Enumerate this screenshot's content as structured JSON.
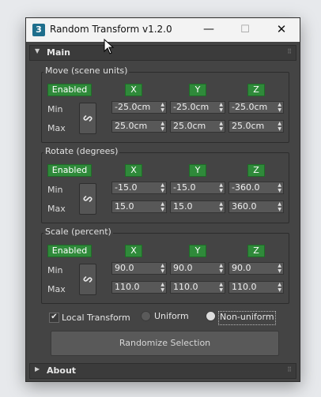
{
  "window": {
    "title": "Random Transform v1.2.0",
    "app_icon_text": "3",
    "controls": {
      "minimize": "—",
      "maximize": "☐",
      "close": "✕"
    }
  },
  "rollouts": {
    "main": {
      "label": "Main",
      "expanded": true,
      "arrow": "▼",
      "grip": "⠿"
    },
    "about": {
      "label": "About",
      "expanded": false,
      "arrow": "▶",
      "grip": "⠿"
    }
  },
  "groups": {
    "move": {
      "title": "Move (scene units)",
      "enabled_label": "Enabled",
      "x_label": "X",
      "y_label": "Y",
      "z_label": "Z",
      "min_label": "Min",
      "max_label": "Max",
      "min": {
        "x": "-25.0cm",
        "y": "-25.0cm",
        "z": "-25.0cm"
      },
      "max": {
        "x": "25.0cm",
        "y": "25.0cm",
        "z": "25.0cm"
      }
    },
    "rotate": {
      "title": "Rotate (degrees)",
      "enabled_label": "Enabled",
      "x_label": "X",
      "y_label": "Y",
      "z_label": "Z",
      "min_label": "Min",
      "max_label": "Max",
      "min": {
        "x": "-15.0",
        "y": "-15.0",
        "z": "-360.0"
      },
      "max": {
        "x": "15.0",
        "y": "15.0",
        "z": "360.0"
      }
    },
    "scale": {
      "title": "Scale (percent)",
      "enabled_label": "Enabled",
      "x_label": "X",
      "y_label": "Y",
      "z_label": "Z",
      "min_label": "Min",
      "max_label": "Max",
      "min": {
        "x": "90.0",
        "y": "90.0",
        "z": "90.0"
      },
      "max": {
        "x": "110.0",
        "y": "110.0",
        "z": "110.0"
      }
    }
  },
  "options": {
    "local_transform_label": "Local Transform",
    "local_transform_checked": true,
    "check_mark": "✔",
    "uniform_label": "Uniform",
    "non_uniform_label": "Non-uniform",
    "selected_scale_mode": "Non-uniform"
  },
  "randomize_button_label": "Randomize Selection",
  "spinner_arrows": "▲\n▼",
  "colors": {
    "enabled_green": "#2f8a3a",
    "panel_bg": "#444444",
    "titlebar_bg": "#f3f3f3",
    "desktop_bg": "#e7e9ec"
  }
}
